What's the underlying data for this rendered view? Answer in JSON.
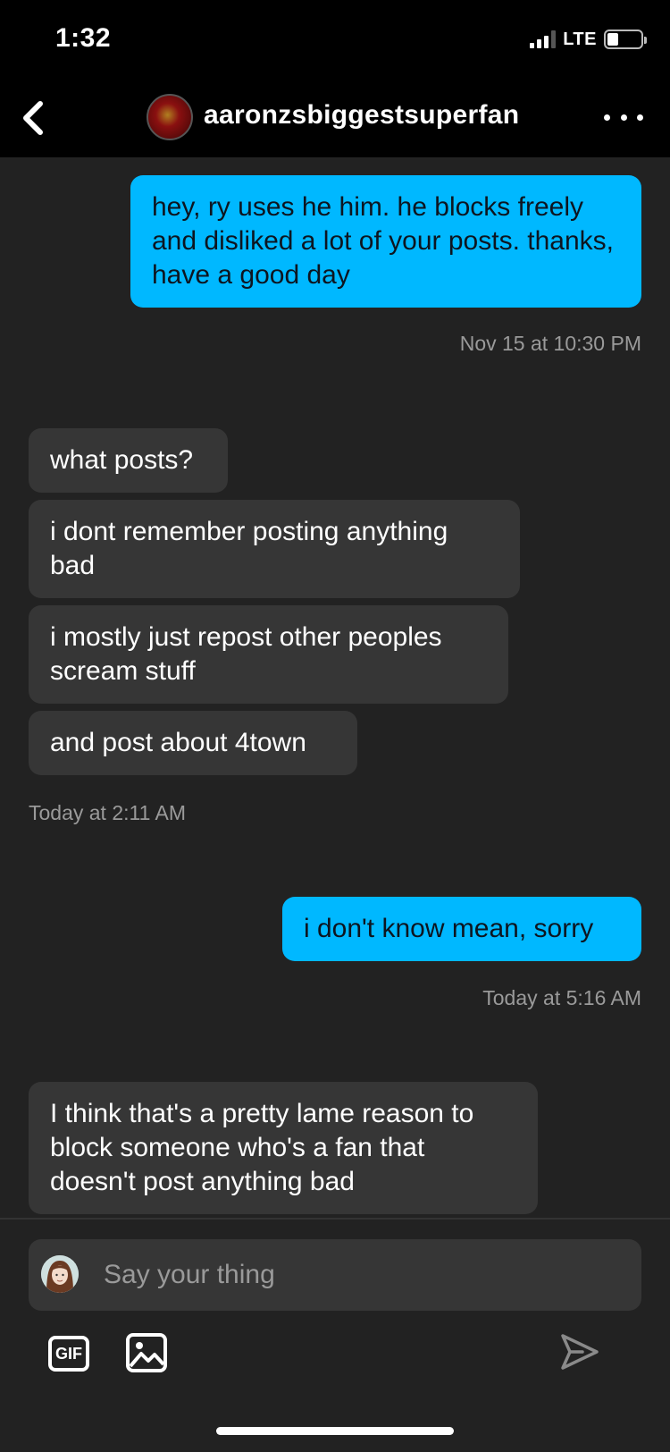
{
  "status_bar": {
    "time": "1:32",
    "network": "LTE"
  },
  "header": {
    "title": "aaronzsbiggestsuperfan"
  },
  "messages": [
    {
      "direction": "out",
      "text": "hey, ry uses he him. he blocks freely and disliked a lot of your posts. thanks, have a good day"
    },
    {
      "direction": "in",
      "text": "what posts?"
    },
    {
      "direction": "in",
      "text": "i dont remember posting anything bad"
    },
    {
      "direction": "in",
      "text": "i mostly just repost other peoples scream stuff"
    },
    {
      "direction": "in",
      "text": "and post about 4town"
    },
    {
      "direction": "out",
      "text": "i don't know mean, sorry"
    },
    {
      "direction": "in",
      "text": "I think that's a pretty lame reason to block someone who's a fan that doesn't post anything bad"
    }
  ],
  "timestamps": [
    "Nov 15 at 10:30 PM",
    "Today at 2:11 AM",
    "Today at 5:16 AM"
  ],
  "composer": {
    "placeholder": "Say your thing",
    "gif_label": "GIF"
  },
  "colors": {
    "outgoing_bubble": "#00b8ff",
    "incoming_bubble": "#363636",
    "background": "#222222"
  }
}
